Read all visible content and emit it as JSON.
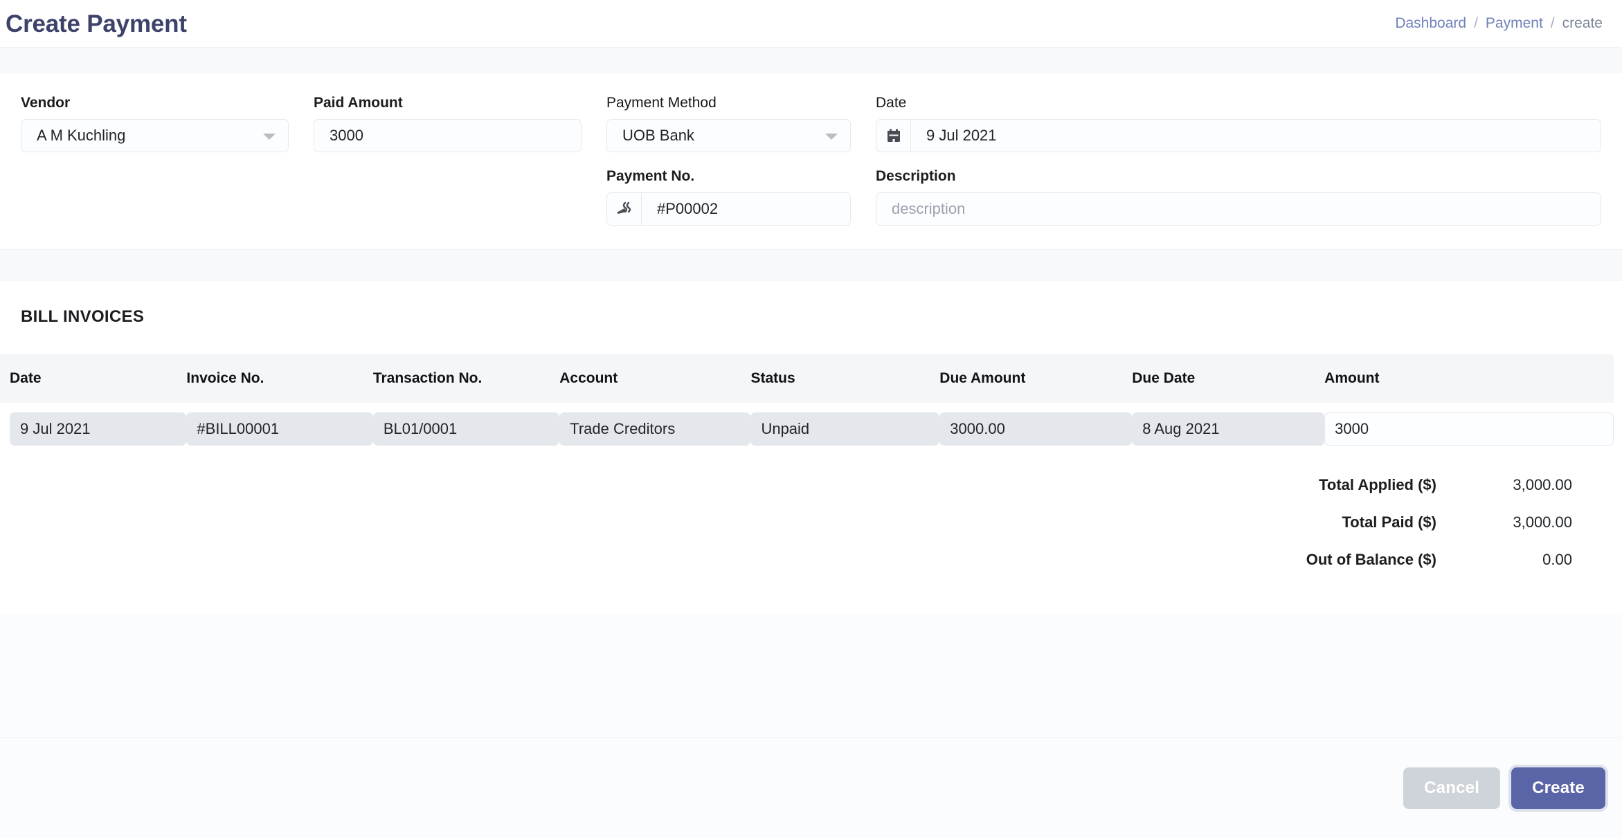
{
  "header": {
    "title": "Create Payment",
    "breadcrumb": [
      {
        "label": "Dashboard",
        "type": "link"
      },
      {
        "label": "/",
        "type": "sep"
      },
      {
        "label": "Payment",
        "type": "link"
      },
      {
        "label": "/",
        "type": "sep"
      },
      {
        "label": "create",
        "type": "current"
      }
    ]
  },
  "form": {
    "vendor": {
      "label": "Vendor",
      "value": "A M Kuchling",
      "icon": "chevron-down-icon"
    },
    "paid_amount": {
      "label": "Paid Amount",
      "value": "3000",
      "placeholder": "Paid Amount"
    },
    "payment_method": {
      "label": "Payment Method",
      "value": "UOB Bank",
      "icon": "chevron-down-icon"
    },
    "payment_no": {
      "label": "Payment No.",
      "value": "#P00002",
      "placeholder": "Payment No.",
      "icon": "pencil-icon"
    },
    "date": {
      "label": "Date",
      "value": "9 Jul 2021",
      "placeholder": "Date",
      "icon": "calendar-icon"
    },
    "description": {
      "label": "Description",
      "value": "",
      "placeholder": "description"
    }
  },
  "invoices": {
    "section_title": "BILL INVOICES",
    "columns": [
      "Date",
      "Invoice No.",
      "Transaction No.",
      "Account",
      "Status",
      "Due Amount",
      "Due Date",
      "Amount"
    ],
    "rows": [
      {
        "date": "9 Jul 2021",
        "invoice_no": "#BILL00001",
        "transaction_no": "BL01/0001",
        "account": "Trade Creditors",
        "status": "Unpaid",
        "due_amount": "3000.00",
        "due_date": "8 Aug 2021",
        "amount": "3000"
      }
    ],
    "totals": [
      {
        "label": "Total Applied ($)",
        "value": "3,000.00"
      },
      {
        "label": "Total Paid ($)",
        "value": "3,000.00"
      },
      {
        "label": "Out of Balance ($)",
        "value": "0.00"
      }
    ]
  },
  "footer": {
    "cancel_label": "Cancel",
    "create_label": "Create"
  },
  "colors": {
    "title": "#3c4269",
    "breadcrumb_link": "#6f81b8",
    "primary_button": "#5a65a8",
    "cancel_button": "#ced4da",
    "readonly_cell": "#e4e7ec",
    "table_header_bg": "#f5f6f7",
    "band_bg": "#f7f9fa"
  }
}
